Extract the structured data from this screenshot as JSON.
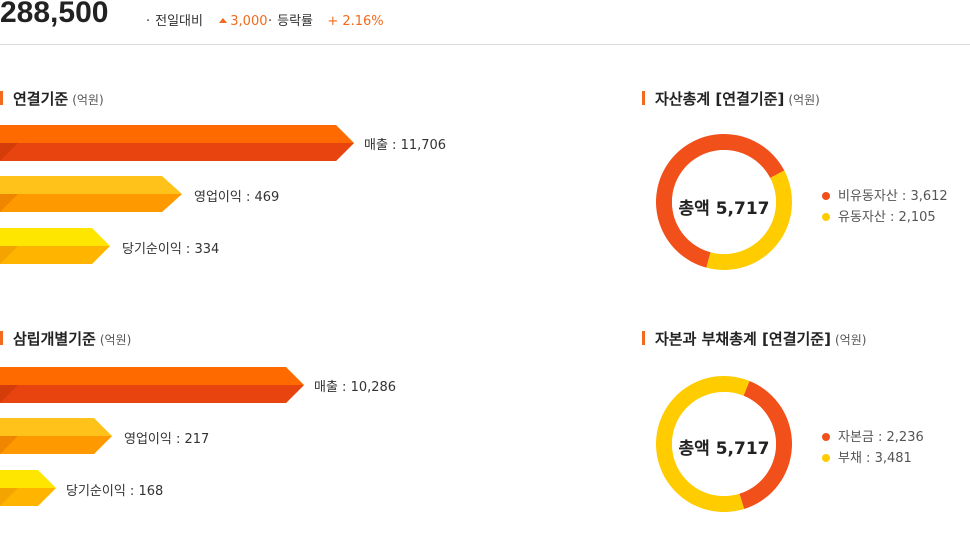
{
  "price": {
    "value": "288,500",
    "change_label": "전일대비",
    "change_value": "3,000",
    "rate_label": "등락률",
    "rate_value": "+ 2.16%"
  },
  "consolidated": {
    "title": "연결기준",
    "unit": "(억원)",
    "bars": [
      {
        "label": "매출 : 11,706",
        "value": 11706
      },
      {
        "label": "영업이익 : 469",
        "value": 469
      },
      {
        "label": "당기순이익 : 334",
        "value": 334
      }
    ]
  },
  "separate": {
    "title": "삼립개별기준",
    "unit": "(억원)",
    "bars": [
      {
        "label": "매출 : 10,286",
        "value": 10286
      },
      {
        "label": "영업이익 : 217",
        "value": 217
      },
      {
        "label": "당기순이익 : 168",
        "value": 168
      }
    ]
  },
  "total_assets": {
    "title": "자산총계 [연결기준]",
    "unit": "(억원)",
    "center": "총액 5,717",
    "items": [
      {
        "label": "비유동자산 : 3,612",
        "value": 3612,
        "color": "#f2501b"
      },
      {
        "label": "유동자산 : 2,105",
        "value": 2105,
        "color": "#ffcc00"
      }
    ]
  },
  "capital_liabilities": {
    "title": "자본과 부채총계 [연결기준]",
    "unit": "(억원)",
    "center": "총액 5,717",
    "items": [
      {
        "label": "자본금 : 2,236",
        "value": 2236,
        "color": "#f2501b"
      },
      {
        "label": "부채 : 3,481",
        "value": 3481,
        "color": "#ffcc00"
      }
    ]
  },
  "colors": {
    "accent": "#f26a1b",
    "bar1_top": "#ff6a00",
    "bar1_bottom": "#e8440f",
    "bar2_top": "#ffc21a",
    "bar2_bottom": "#ff9900",
    "bar3_top": "#ffe600",
    "bar3_bottom": "#ffb400"
  }
}
